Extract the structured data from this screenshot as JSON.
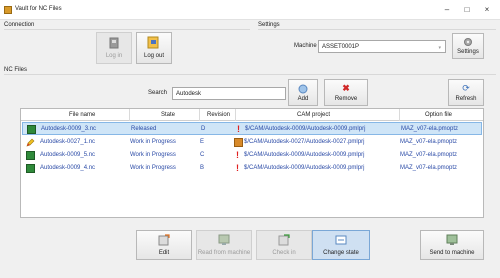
{
  "window": {
    "title": "Vault for NC Files",
    "minimize": "–",
    "maximize": "□",
    "close": "×"
  },
  "connection": {
    "label": "Connection",
    "login_label": "Log in",
    "logout_label": "Log out"
  },
  "settings": {
    "label": "Settings",
    "machine_label": "Machine",
    "machine_value": "ASSET0001P",
    "settings_button": "Settings"
  },
  "nc_files": {
    "label": "NC Files",
    "search_label": "Search",
    "search_value": "Autodesk",
    "add_label": "Add",
    "remove_label": "Remove",
    "refresh_label": "Refresh"
  },
  "table": {
    "columns": [
      "File name",
      "State",
      "Revision",
      "CAM project",
      "Option file"
    ],
    "rows": [
      {
        "file": "Autodesk-0009_3.nc",
        "state": "Released",
        "revision": "D",
        "cam": "$/CAM/Autodesk-0009/Autodesk-0009.pmlprj",
        "option": "MAZ_v07-ela.pmoptz",
        "icon": "nc-file-icon",
        "cam_icon": "warning-icon"
      },
      {
        "file": "Autodesk-0027_1.nc",
        "state": "Work in Progress",
        "revision": "E",
        "cam": "$/CAM/Autodesk-0027/Autodesk-0027.pmlprj",
        "option": "MAZ_v07-ela.pmoptz",
        "icon": "pencil-icon",
        "cam_icon": "locked-project-icon"
      },
      {
        "file": "Autodesk-0009_5.nc",
        "state": "Work in Progress",
        "revision": "C",
        "cam": "$/CAM/Autodesk-0009/Autodesk-0009.pmlprj",
        "option": "MAZ_v07-ela.pmoptz",
        "icon": "nc-file-icon",
        "cam_icon": "warning-icon"
      },
      {
        "file": "Autodesk-0009_4.nc",
        "state": "Work in Progress",
        "revision": "B",
        "cam": "$/CAM/Autodesk-0009/Autodesk-0009.pmlprj",
        "option": "MAZ_v07-ela.pmoptz",
        "icon": "nc-file-icon",
        "cam_icon": "warning-icon"
      }
    ]
  },
  "actions": {
    "edit": "Edit",
    "read_from_machine": "Read from machine",
    "check_in": "Check in",
    "change_state": "Change state",
    "send_to_machine": "Send to machine"
  },
  "colors": {
    "link_text": "#2a4aa6",
    "selected_row": "#cfe5f7",
    "warning": "#e02020"
  }
}
